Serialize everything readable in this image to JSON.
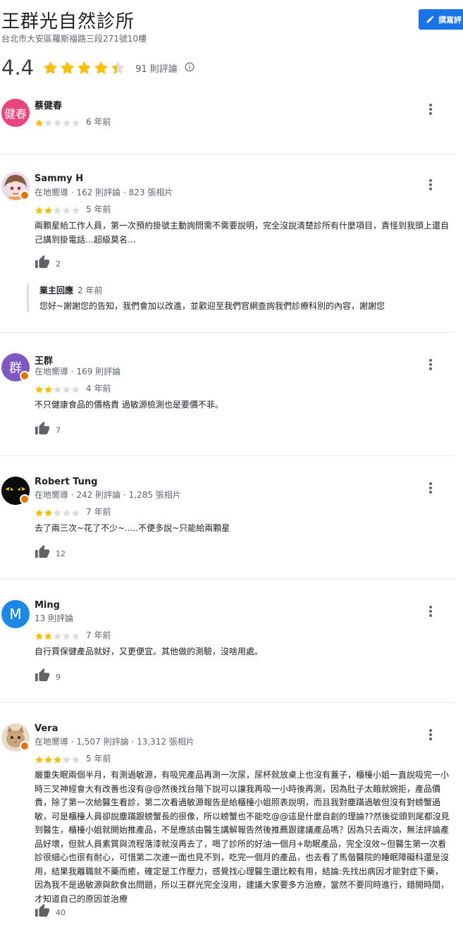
{
  "business": {
    "name": "王群光自然診所",
    "address": "台北市大安區羅斯福路三段271號10樓",
    "rating": "4.4",
    "rating_value": 4.4,
    "review_count": "91 則評論",
    "write_review_label": "撰寫評"
  },
  "colors": {
    "star_filled": "#fbbc04",
    "star_empty": "#dadce0",
    "accent": "#1a73e8",
    "badge": "#e37400"
  },
  "reviews": [
    {
      "name": "蔡健春",
      "avatar_text": "健春",
      "avatar_color": "#e8457a",
      "meta": "",
      "rating": 1,
      "time": "6 年前",
      "text": "",
      "likes": ""
    },
    {
      "name": "Sammy H",
      "avatar_text": "",
      "avatar_color": "#c9b8e8",
      "meta": "在地嚮導 · 162 則評論 · 823 張相片",
      "rating": 2,
      "time": "5 年前",
      "text": "兩顆星給工作人員，第一次預約掛號主動詢問需不需要說明，完全沒說清楚診所有什麼項目，責怪到我頭上還自己講到掛電話…超級莫名…",
      "likes": "2",
      "owner_reply": {
        "title": "業主回應",
        "time": "2 年前",
        "text": "您好~謝謝您的告知，我們會加以改進，並歡迎至我們官網查詢我們診療科別的內容，謝謝您"
      }
    },
    {
      "name": "王群",
      "avatar_text": "群",
      "avatar_color": "#7e57c2",
      "meta": "在地嚮導 · 169 則評論",
      "rating": 2,
      "time": "4 年前",
      "text": "不只健康食品的價格貴  過敏源檢測也是要價不菲。",
      "likes": "7"
    },
    {
      "name": "Robert Tung",
      "avatar_text": "",
      "avatar_color": "#111111",
      "meta": "在地嚮導 · 242 則評論 · 1,285 張相片",
      "rating": 2,
      "time": "7 年前",
      "text": "去了兩三次~花了不少~.....不便多說~只能給兩顆星",
      "likes": "12"
    },
    {
      "name": "Ming",
      "avatar_text": "M",
      "avatar_color": "#1e88e5",
      "meta": "13 則評論",
      "rating": 2,
      "time": "7 年前",
      "text": "自行買保健產品就好，又更便宜。其他做的測驗，沒啥用處。",
      "likes": "9"
    },
    {
      "name": "Vera",
      "avatar_text": "",
      "avatar_color": "#d8c3a5",
      "meta": "在地嚮導 · 1,507 則評論 · 13,312 張相片",
      "rating": 3,
      "time": "5 年前",
      "text": "嚴重失眠兩個半月，有測過敏源，有吸完產品再測一次尿，尿杯就放桌上也沒有蓋子，櫃檯小姐一直說吸完一小時三叉神經會大有改善也沒有@@然後找台階下說可以讓我再吸一小時後再測，因為肚子太餓就婉拒，產品價貴，除了第一次給醫生看診，第二次看過敏源報告是給櫃檯小姐照表說明，而且我對塵蹣過敏但沒有對螃蟹過敏，可是櫃檯人員卻說塵蹣跟螃蟹長的很像，所以螃蟹也不能吃@@這是什麼自創的理論??然後從頭到尾都沒見到醫生，櫃檯小姐就開始推產品，不是應該由醫生講解報告然後推薦跟建議產品嗎？因為只去兩次，無法評論產品好壞，但就人員素質與流程落漆就沒再去了，喝了診所的好油一個月+助眠產品，完全沒效~但醫生第一次看診很細心也很有耐心，可惜第二次連一面也見不到，吃完一個月的產品，也去看了馬偕醫院的睡眠障礙科還是沒用，結果我離職就不藥而癒，確定是工作壓力，感覺找心理醫生還比較有用，結論:先找出病因才能對症下藥，因為我不是過敏源與飲食出問題，所以王群光完全沒用，建議大家要多方治療，當然不要同時進行，錯開時間，才知道自己的原因並治療",
      "likes": "40"
    }
  ]
}
